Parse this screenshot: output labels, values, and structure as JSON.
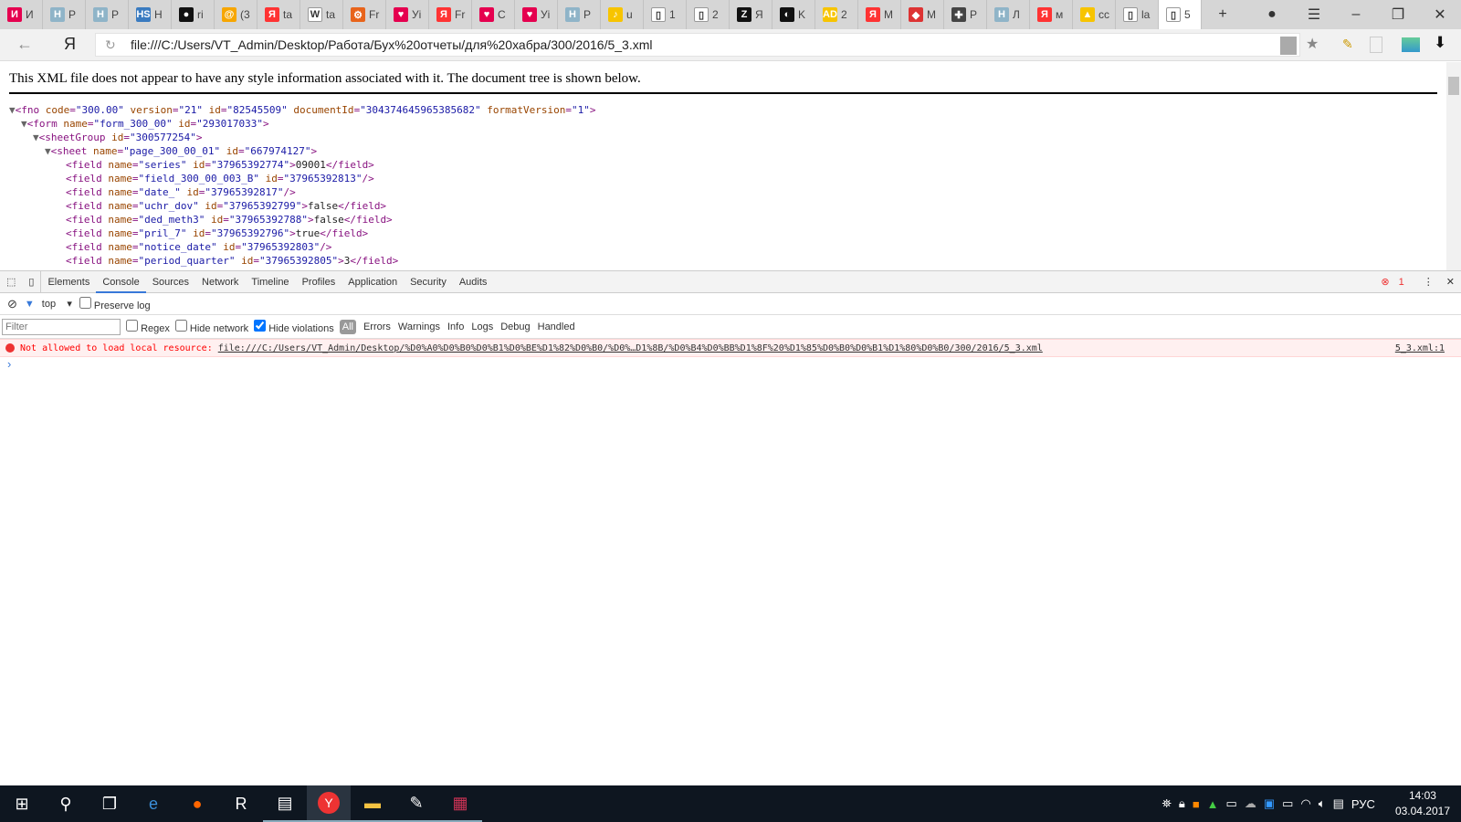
{
  "browser": {
    "tabs": [
      {
        "icon": "И",
        "title": "И",
        "color": "#e5004f"
      },
      {
        "icon": "H",
        "title": "Р",
        "color": "#8fb4c8"
      },
      {
        "icon": "H",
        "title": "Р",
        "color": "#8fb4c8"
      },
      {
        "icon": "HS",
        "title": "H",
        "color": "#3a7bc0"
      },
      {
        "icon": "●",
        "title": "ri",
        "color": "#111"
      },
      {
        "icon": "@",
        "title": "(3",
        "color": "#f7a600"
      },
      {
        "icon": "Я",
        "title": "ta",
        "color": "#f33"
      },
      {
        "icon": "W",
        "title": "ta",
        "color": "#fff"
      },
      {
        "icon": "⚙",
        "title": "Fr",
        "color": "#e8641b"
      },
      {
        "icon": "♥",
        "title": "Уі",
        "color": "#e5004f"
      },
      {
        "icon": "Я",
        "title": "Fr",
        "color": "#f33"
      },
      {
        "icon": "♥",
        "title": "С",
        "color": "#e5004f"
      },
      {
        "icon": "♥",
        "title": "Уі",
        "color": "#e5004f"
      },
      {
        "icon": "H",
        "title": "Р",
        "color": "#8fb4c8"
      },
      {
        "icon": "♪",
        "title": "u",
        "color": "#f7c400"
      },
      {
        "icon": "▯",
        "title": "1",
        "color": "#fff"
      },
      {
        "icon": "▯",
        "title": "2",
        "color": "#fff"
      },
      {
        "icon": "Z",
        "title": "Я",
        "color": "#111"
      },
      {
        "icon": "◐",
        "title": "K",
        "color": "#111"
      },
      {
        "icon": "AD",
        "title": "2",
        "color": "#f7c400"
      },
      {
        "icon": "Я",
        "title": "M",
        "color": "#f33"
      },
      {
        "icon": "◆",
        "title": "M",
        "color": "#d33"
      },
      {
        "icon": "✚",
        "title": "Р",
        "color": "#444"
      },
      {
        "icon": "H",
        "title": "Л",
        "color": "#8fb4c8"
      },
      {
        "icon": "Я",
        "title": "м",
        "color": "#f33"
      },
      {
        "icon": "▲",
        "title": "cc",
        "color": "#f7c400"
      },
      {
        "icon": "▯",
        "title": "la",
        "color": "#fff"
      },
      {
        "icon": "▯",
        "title": "5",
        "color": "#fff",
        "active": true
      }
    ],
    "url": "file:///C:/Users/VT_Admin/Desktop/Работа/Бух%20отчеты/для%20хабра/300/2016/5_3.xml"
  },
  "page": {
    "notice": "This XML file does not appear to have any style information associated with it. The document tree is shown below.",
    "xml_lines": [
      {
        "indent": 0,
        "toggle": "▼",
        "html": "<span class='t'>&lt;fno</span> <span class='a'>code</span><span class='t'>=</span><span class='v'>\"300.00\"</span> <span class='a'>version</span><span class='t'>=</span><span class='v'>\"21\"</span> <span class='a'>id</span><span class='t'>=</span><span class='v'>\"82545509\"</span> <span class='a'>documentId</span><span class='t'>=</span><span class='v'>\"304374645965385682\"</span> <span class='a'>formatVersion</span><span class='t'>=</span><span class='v'>\"1\"</span><span class='t'>&gt;</span>"
      },
      {
        "indent": 1,
        "toggle": "▼",
        "html": "<span class='t'>&lt;form</span> <span class='a'>name</span><span class='t'>=</span><span class='v'>\"form_300_00\"</span> <span class='a'>id</span><span class='t'>=</span><span class='v'>\"293017033\"</span><span class='t'>&gt;</span>"
      },
      {
        "indent": 2,
        "toggle": "▼",
        "html": "<span class='t'>&lt;sheetGroup</span> <span class='a'>id</span><span class='t'>=</span><span class='v'>\"300577254\"</span><span class='t'>&gt;</span>"
      },
      {
        "indent": 3,
        "toggle": "▼",
        "html": "<span class='t'>&lt;sheet</span> <span class='a'>name</span><span class='t'>=</span><span class='v'>\"page_300_00_01\"</span> <span class='a'>id</span><span class='t'>=</span><span class='v'>\"667974127\"</span><span class='t'>&gt;</span>"
      },
      {
        "indent": 4,
        "toggle": "",
        "html": "<span class='t'>&lt;field</span> <span class='a'>name</span><span class='t'>=</span><span class='v'>\"series\"</span> <span class='a'>id</span><span class='t'>=</span><span class='v'>\"37965392774\"</span><span class='t'>&gt;</span>09001<span class='t'>&lt;/field&gt;</span>"
      },
      {
        "indent": 4,
        "toggle": "",
        "html": "<span class='t'>&lt;field</span> <span class='a'>name</span><span class='t'>=</span><span class='v'>\"field_300_00_003_B\"</span> <span class='a'>id</span><span class='t'>=</span><span class='v'>\"37965392813\"</span><span class='t'>/&gt;</span>"
      },
      {
        "indent": 4,
        "toggle": "",
        "html": "<span class='t'>&lt;field</span> <span class='a'>name</span><span class='t'>=</span><span class='v'>\"date_\"</span> <span class='a'>id</span><span class='t'>=</span><span class='v'>\"37965392817\"</span><span class='t'>/&gt;</span>"
      },
      {
        "indent": 4,
        "toggle": "",
        "html": "<span class='t'>&lt;field</span> <span class='a'>name</span><span class='t'>=</span><span class='v'>\"uchr_dov\"</span> <span class='a'>id</span><span class='t'>=</span><span class='v'>\"37965392799\"</span><span class='t'>&gt;</span>false<span class='t'>&lt;/field&gt;</span>"
      },
      {
        "indent": 4,
        "toggle": "",
        "html": "<span class='t'>&lt;field</span> <span class='a'>name</span><span class='t'>=</span><span class='v'>\"ded_meth3\"</span> <span class='a'>id</span><span class='t'>=</span><span class='v'>\"37965392788\"</span><span class='t'>&gt;</span>false<span class='t'>&lt;/field&gt;</span>"
      },
      {
        "indent": 4,
        "toggle": "",
        "html": "<span class='t'>&lt;field</span> <span class='a'>name</span><span class='t'>=</span><span class='v'>\"pril_7\"</span> <span class='a'>id</span><span class='t'>=</span><span class='v'>\"37965392796\"</span><span class='t'>&gt;</span>true<span class='t'>&lt;/field&gt;</span>"
      },
      {
        "indent": 4,
        "toggle": "",
        "html": "<span class='t'>&lt;field</span> <span class='a'>name</span><span class='t'>=</span><span class='v'>\"notice_date\"</span> <span class='a'>id</span><span class='t'>=</span><span class='v'>\"37965392803\"</span><span class='t'>/&gt;</span>"
      },
      {
        "indent": 4,
        "toggle": "",
        "html": "<span class='t'>&lt;field</span> <span class='a'>name</span><span class='t'>=</span><span class='v'>\"period_quarter\"</span> <span class='a'>id</span><span class='t'>=</span><span class='v'>\"37965392805\"</span><span class='t'>&gt;</span>3<span class='t'>&lt;/field&gt;</span>"
      }
    ]
  },
  "devtools": {
    "tabs": [
      "Elements",
      "Console",
      "Sources",
      "Network",
      "Timeline",
      "Profiles",
      "Application",
      "Security",
      "Audits"
    ],
    "active_tab": "Console",
    "error_count": "1",
    "context": "top",
    "preserve_log": "Preserve log",
    "filter_placeholder": "Filter",
    "regex": "Regex",
    "hide_network": "Hide network",
    "hide_violations": "Hide violations",
    "levels": [
      "All",
      "Errors",
      "Warnings",
      "Info",
      "Logs",
      "Debug",
      "Handled"
    ],
    "error_message": "Not allowed to load local resource:",
    "error_url": "file:///C:/Users/VT_Admin/Desktop/%D0%A0%D0%B0%D0%B1%D0%BE%D1%82%D0%B0/%D0%…D1%8B/%D0%B4%D0%BB%D1%8F%20%D1%85%D0%B0%D0%B1%D1%80%D0%B0/300/2016/5_3.xml",
    "error_source": "5_3.xml:1",
    "prompt": "›"
  },
  "taskbar": {
    "lang": "РУС",
    "time": "14:03",
    "date": "03.04.2017"
  }
}
